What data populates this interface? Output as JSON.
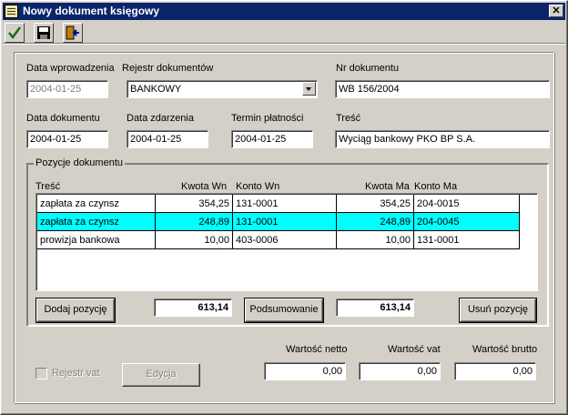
{
  "window": {
    "title": "Nowy dokument księgowy",
    "close_glyph": "✕"
  },
  "toolbar": {
    "icons": [
      "check-icon",
      "save-disk-icon",
      "exit-door-icon"
    ]
  },
  "form": {
    "entry_date": {
      "label": "Data wprowadzenia",
      "value": "2004-01-25"
    },
    "register": {
      "label": "Rejestr dokumentów",
      "value": "BANKOWY"
    },
    "doc_number": {
      "label": "Nr dokumentu",
      "value": "WB 156/2004"
    },
    "doc_date": {
      "label": "Data dokumentu",
      "value": "2004-01-25"
    },
    "event_date": {
      "label": "Data zdarzenia",
      "value": "2004-01-25"
    },
    "due_date": {
      "label": "Termin płatności",
      "value": "2004-01-25"
    },
    "content": {
      "label": "Treść",
      "value": "Wyciąg bankowy PKO BP S.A."
    }
  },
  "positions": {
    "group_title": "Pozycje dokumentu",
    "columns": [
      "Treść",
      "Kwota Wn",
      "Konto Wn",
      "Kwota Ma",
      "Konto Ma"
    ],
    "rows": [
      {
        "desc": "zapłata za czynsz",
        "kwota_wn": "354,25",
        "konto_wn": "131-0001",
        "kwota_ma": "354,25",
        "konto_ma": "204-0015",
        "selected": false
      },
      {
        "desc": "zapłata za czynsz",
        "kwota_wn": "248,89",
        "konto_wn": "131-0001",
        "kwota_ma": "248,89",
        "konto_ma": "204-0045",
        "selected": true
      },
      {
        "desc": "prowizja bankowa",
        "kwota_wn": "10,00",
        "konto_wn": "403-0006",
        "kwota_ma": "10,00",
        "konto_ma": "131-0001",
        "selected": false
      }
    ],
    "add_button": "Dodaj pozycję",
    "sum_wn": "613,14",
    "summary_button": "Podsumowanie",
    "sum_ma": "613,14",
    "remove_button": "Usuń pozycję"
  },
  "totals": {
    "net": {
      "label": "Wartość netto",
      "value": "0,00"
    },
    "vat": {
      "label": "Wartość vat",
      "value": "0,00"
    },
    "gross": {
      "label": "Wartość brutto",
      "value": "0,00"
    }
  },
  "vat_register": {
    "label": "Rejestr vat",
    "edit_button": "Edycja"
  },
  "colors": {
    "title_bar": "#0a246a",
    "selection": "#00ffff",
    "face": "#d4d0c8"
  }
}
